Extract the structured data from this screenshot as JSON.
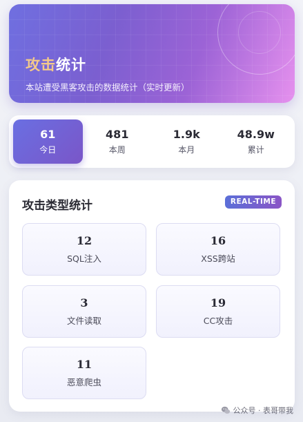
{
  "banner": {
    "title_accent": "攻击",
    "title_rest": "统计",
    "subtitle": "本站遭受黑客攻击的数据统计（实时更新）"
  },
  "tabs": [
    {
      "value": "61",
      "label": "今日",
      "active": true
    },
    {
      "value": "481",
      "label": "本周",
      "active": false
    },
    {
      "value": "1.9k",
      "label": "本月",
      "active": false
    },
    {
      "value": "48.9w",
      "label": "累计",
      "active": false
    }
  ],
  "card": {
    "title": "攻击类型统计",
    "badge": "REAL-TIME",
    "stats": [
      {
        "value": "12",
        "label": "SQL注入"
      },
      {
        "value": "16",
        "label": "XSS跨站"
      },
      {
        "value": "3",
        "label": "文件读取"
      },
      {
        "value": "19",
        "label": "CC攻击"
      },
      {
        "value": "11",
        "label": "恶意爬虫"
      }
    ]
  },
  "watermark": {
    "text": "公众号 · 表哥带我",
    "icon": "wechat-icon"
  },
  "colors": {
    "accent": "#6a6fe2",
    "banner_accent": "#f3c98a",
    "badge": "#5b6fd8"
  }
}
